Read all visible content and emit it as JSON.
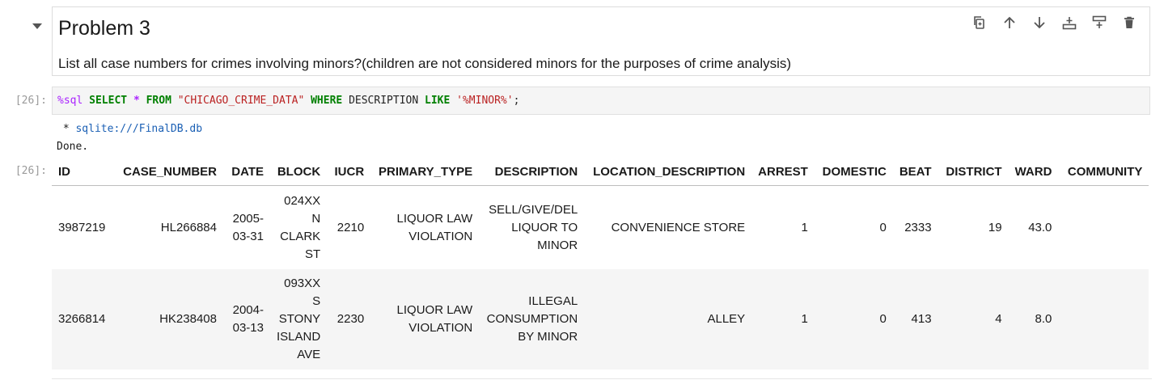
{
  "markdown_cell": {
    "title": "Problem 3",
    "text": "List all case numbers for crimes involving minors?(children are not considered minors for the purposes of crime analysis)"
  },
  "toolbar": {
    "icons": [
      "duplicate-icon",
      "move-up-icon",
      "move-down-icon",
      "insert-above-icon",
      "insert-below-icon",
      "delete-icon"
    ]
  },
  "code_cell": {
    "prompt": "[26]:",
    "tokens": {
      "magic": "%sql",
      "select": "SELECT",
      "star": "*",
      "from": "FROM",
      "table": "\"CHICAGO_CRIME_DATA\"",
      "where": "WHERE",
      "column": "DESCRIPTION",
      "like": "LIKE",
      "pattern": "'%MINOR%'",
      "semicolon": ";"
    }
  },
  "output": {
    "connection_prefix": " * ",
    "connection": "sqlite:///FinalDB.db",
    "status": "Done.",
    "prompt": "[26]:"
  },
  "table": {
    "columns": [
      "ID",
      "CASE_NUMBER",
      "DATE",
      "BLOCK",
      "IUCR",
      "PRIMARY_TYPE",
      "DESCRIPTION",
      "LOCATION_DESCRIPTION",
      "ARREST",
      "DOMESTIC",
      "BEAT",
      "DISTRICT",
      "WARD",
      "COMMUNITY"
    ],
    "rows": [
      [
        "3987219",
        "HL266884",
        "2005-03-31",
        "024XX N CLARK ST",
        "2210",
        "LIQUOR LAW VIOLATION",
        "SELL/GIVE/DEL LIQUOR TO MINOR",
        "CONVENIENCE STORE",
        "1",
        "0",
        "2333",
        "19",
        "43.0",
        ""
      ],
      [
        "3266814",
        "HK238408",
        "2004-03-13",
        "093XX S STONY ISLAND AVE",
        "2230",
        "LIQUOR LAW VIOLATION",
        "ILLEGAL CONSUMPTION BY MINOR",
        "ALLEY",
        "1",
        "0",
        "413",
        "4",
        "8.0",
        ""
      ]
    ]
  }
}
